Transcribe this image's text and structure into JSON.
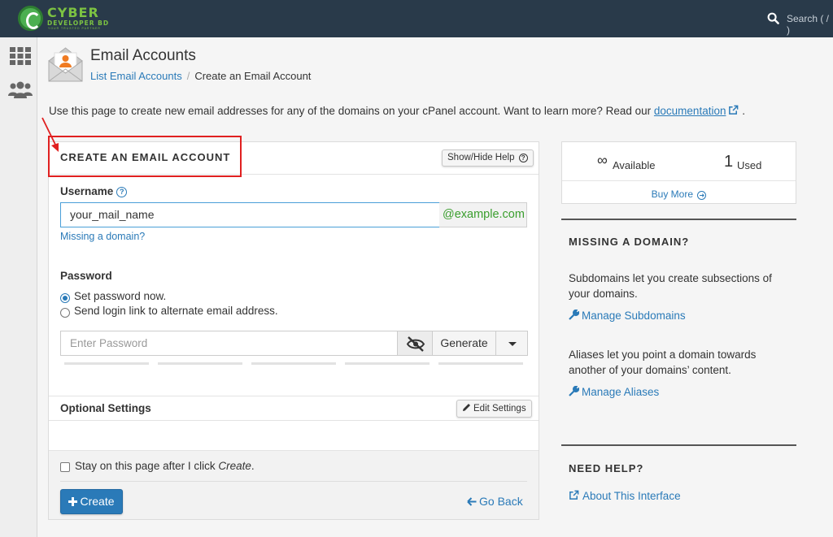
{
  "brand": {
    "name": "CYBER",
    "subtitle": "DEVELOPER BD",
    "tagline": "YOUR TRUSTED PARTNER"
  },
  "topbar": {
    "search_placeholder": "Search ( / )"
  },
  "header": {
    "title": "Email Accounts",
    "breadcrumb": {
      "parent": "List Email Accounts",
      "separator": "/",
      "current": "Create an Email Account"
    }
  },
  "intro": {
    "text": "Use this page to create new email addresses for any of the domains on your cPanel account. Want to learn more? Read our ",
    "link": "documentation",
    "suffix": "."
  },
  "form": {
    "title": "CREATE AN EMAIL ACCOUNT",
    "help_button": "Show/Hide Help",
    "username_label": "Username",
    "username_value": "your_mail_name",
    "domain_suffix": "@example.com",
    "missing_domain_link": "Missing a domain?",
    "password_label": "Password",
    "password_options": [
      "Set password now.",
      "Send login link to alternate email address."
    ],
    "password_selected": 0,
    "password_placeholder": "Enter Password",
    "generate_button": "Generate",
    "strength_level": 0,
    "optional_settings_label": "Optional Settings",
    "edit_settings_button": "Edit Settings",
    "stay_prefix": "Stay on this page after I click ",
    "stay_emphasis": "Create",
    "stay_suffix": ".",
    "stay_checked": false,
    "create_button": "Create",
    "go_back_link": "Go Back"
  },
  "stats": {
    "available_symbol": "∞",
    "available_label": "Available",
    "used_count": "1",
    "used_label": "Used",
    "buy_more": "Buy More"
  },
  "sidebar": {
    "missing_domain": {
      "heading": "MISSING A DOMAIN?",
      "subdomains_text": "Subdomains let you create subsections of your domains.",
      "subdomains_link": "Manage Subdomains",
      "aliases_text": "Aliases let you point a domain towards another of your domains’ content.",
      "aliases_link": "Manage Aliases"
    },
    "need_help": {
      "heading": "NEED HELP?",
      "link": "About This Interface"
    }
  },
  "colors": {
    "topbar": "#293a4a",
    "link": "#2a7ab8",
    "brand_green": "#7cc242",
    "annotation_red": "#e02020",
    "domain_green": "#3a9e2d"
  },
  "icons": [
    "search-icon",
    "apps-grid-icon",
    "users-icon",
    "email-envelope-icon",
    "external-link-icon",
    "question-circle-icon",
    "eye-slash-icon",
    "caret-down-icon",
    "pencil-icon",
    "plus-icon",
    "arrow-left-icon",
    "arrow-right-circle-icon",
    "wrench-icon",
    "infinity-icon"
  ]
}
